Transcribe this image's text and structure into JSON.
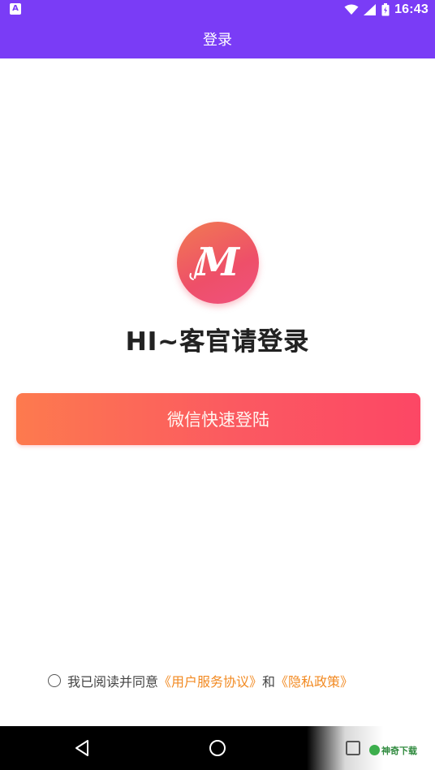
{
  "status_bar": {
    "time": "16:43",
    "left_icon": "notification-a-icon",
    "icons": [
      "wifi-icon",
      "signal-icon",
      "battery-icon"
    ]
  },
  "app_bar": {
    "title": "登录"
  },
  "logo": {
    "letter": "M",
    "icon": "app-logo-m-icon"
  },
  "welcome": {
    "title": "HI~客官请登录"
  },
  "login": {
    "wechat_button_label": "微信快速登陆"
  },
  "agreement": {
    "prefix": "我已阅读并同意",
    "user_agreement_link": "《用户服务协议》",
    "conjunction": "和",
    "privacy_link": "《隐私政策》",
    "checked": false
  },
  "nav_bar": {
    "buttons": [
      "back-icon",
      "home-icon",
      "recents-icon"
    ]
  },
  "watermark": {
    "text": "神奇下载"
  },
  "colors": {
    "primary": "#7a3cf6",
    "button_start": "#fd7a4e",
    "button_end": "#fc4765",
    "link": "#f28a22"
  }
}
